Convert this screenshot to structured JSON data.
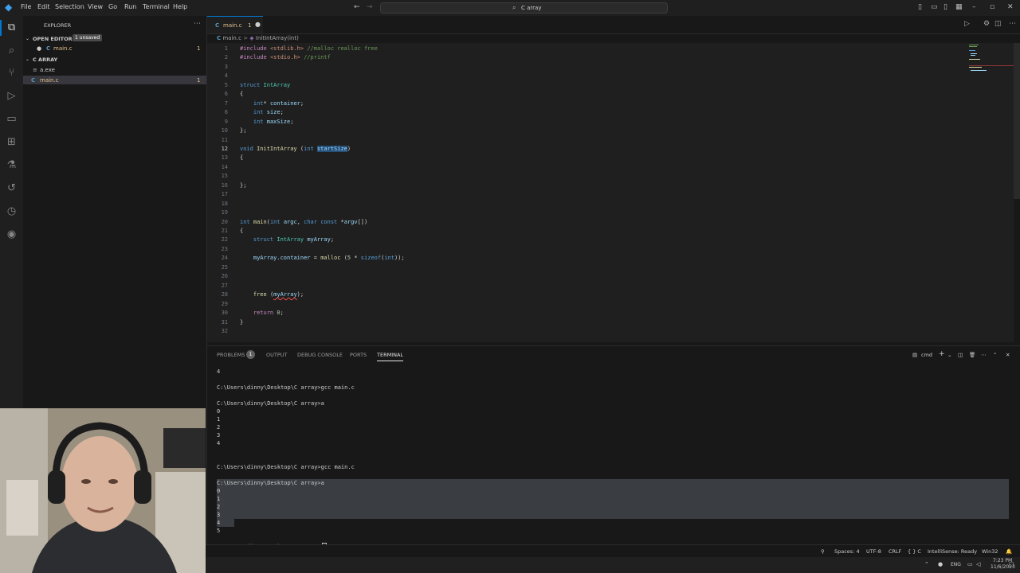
{
  "menu": [
    "File",
    "Edit",
    "Selection",
    "View",
    "Go",
    "Run",
    "Terminal",
    "Help"
  ],
  "search": {
    "text": "C array"
  },
  "sidebar": {
    "title": "EXPLORER",
    "open_editors": "OPEN EDITORS",
    "unsaved": "1 unsaved",
    "open_file": "main.c",
    "open_file_count": "1",
    "folder": "C ARRAY",
    "files": [
      {
        "name": "a.exe",
        "icon": "≡"
      },
      {
        "name": "main.c",
        "icon": "C",
        "count": "1"
      }
    ]
  },
  "tab": {
    "label": "main.c",
    "count": "1"
  },
  "breadcrumb": {
    "file": "main.c",
    "symbol": "InitIntArray(int)"
  },
  "code_lines": [
    "#include <stdlib.h> //malloc realloc free",
    "#include <stdio.h> //printf",
    "",
    "",
    "struct IntArray",
    "{",
    "    int* container;",
    "    int size;",
    "    int maxSize;",
    "};",
    "",
    "void InitIntArray (int startSize)",
    "{",
    "",
    "",
    "};",
    "",
    "",
    "",
    "int main(int argc, char const *argv[])",
    "{",
    "    struct IntArray myArray;",
    "",
    "    myArray.container = malloc (5 * sizeof(int));",
    "",
    "",
    "",
    "    free (myArray);",
    "",
    "    return 0;",
    "}",
    ""
  ],
  "panel": {
    "tabs": [
      "PROBLEMS",
      "OUTPUT",
      "DEBUG CONSOLE",
      "PORTS",
      "TERMINAL"
    ],
    "problems_count": "1",
    "shell": "cmd",
    "terminal_lines": [
      "4",
      "",
      "C:\\Users\\dinny\\Desktop\\C array>gcc main.c",
      "",
      "C:\\Users\\dinny\\Desktop\\C array>a",
      "0",
      "1",
      "2",
      "3",
      "4",
      "",
      "",
      "C:\\Users\\dinny\\Desktop\\C array>gcc main.c",
      "",
      "C:\\Users\\dinny\\Desktop\\C array>a",
      "0",
      "1",
      "2",
      "3",
      "4",
      "5",
      "",
      "C:\\Users\\dinny\\Desktop\\C array>"
    ]
  },
  "status": {
    "spaces": "Spaces: 4",
    "encoding": "UTF-8",
    "eol": "CRLF",
    "language": "{ } C",
    "intellisense": "IntelliSense: Ready",
    "platform": "Win32"
  },
  "taskbar": {
    "lang": "ENG",
    "time": "7:23 PM",
    "date": "11/6/2023"
  },
  "colors": {
    "accent": "#0078d4",
    "modified": "#e2c08d",
    "error": "#f14c4c"
  }
}
